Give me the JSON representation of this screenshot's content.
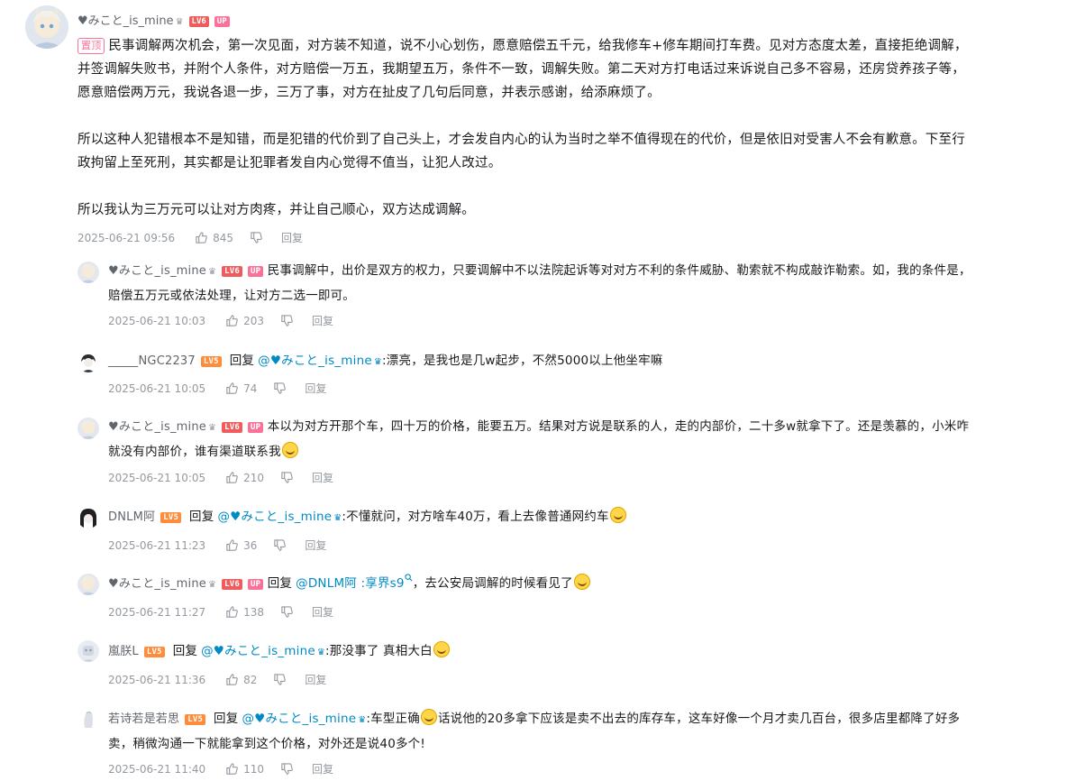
{
  "main_comment": {
    "username": "♥みこと_is_mine",
    "crown": "♛",
    "level": "LV6",
    "up_badge": "UP",
    "pinned_label": "置顶",
    "para1_line1": "民事调解两次机会，第一次见面，对方装不知道，说不小心划伤，愿意赔偿五千元，给我修车+修车期间打车费。见对方态度太差，直接拒绝调解，",
    "para1_line2": "并签调解失败书，并附个人条件，对方赔偿一万五，我期望五万，条件不一致，调解失败。第二天对方打电话过来诉说自己多不容易，还房贷养孩子等，",
    "para1_line3": "愿意赔偿两万元，我说各退一步，三万了事，对方在扯皮了几句后同意，并表示感谢，给添麻烦了。",
    "para2_line1": "所以这种人犯错根本不是知错，而是犯错的代价到了自己头上，才会发自内心的认为当时之举不值得现在的代价，但是依旧对受害人不会有歉意。下至行",
    "para2_line2": "政拘留上至死刑，其实都是让犯罪者发自内心觉得不值当，让犯人改过。",
    "para3": "所以我认为三万元可以让对方肉疼，并让自己顺心，双方达成调解。",
    "time": "2025-06-21 09:56",
    "likes": "845",
    "reply_label": "回复"
  },
  "replies": [
    {
      "username": "♥みこと_is_mine",
      "crown": "♛",
      "level": "LV6",
      "up_badge": "UP",
      "line1": "民事调解中，出价是双方的权力，只要调解中不以法院起诉等对对方不利的条件威胁、勒索就不构成敲诈勒索。如，我的条件是，",
      "line2": "赔偿五万元或依法处理，让对方二选一即可。",
      "time": "2025-06-21 10:03",
      "likes": "203",
      "reply_label": "回复"
    },
    {
      "username": "_____NGC2237",
      "level": "LV5",
      "reply_word": "回复",
      "mention": "@♥みこと_is_mine",
      "mention_crown": "♛",
      "text": ":漂亮，是我也是几w起步，不然5000以上他坐牢嘛",
      "time": "2025-06-21 10:05",
      "likes": "74",
      "reply_label": "回复"
    },
    {
      "username": "♥みこと_is_mine",
      "crown": "♛",
      "level": "LV6",
      "up_badge": "UP",
      "line1": "本以为对方开那个车，四十万的价格，能要五万。结果对方说是联系的人，走的内部价，二十多w就拿下了。还是羡慕的，小米咋",
      "line2": "就没有内部价，谁有渠道联系我",
      "time": "2025-06-21 10:05",
      "likes": "210",
      "reply_label": "回复"
    },
    {
      "username": "DNLM阿",
      "level": "LV5",
      "reply_word": "回复",
      "mention": "@♥みこと_is_mine",
      "mention_crown": "♛",
      "text": ":不懂就问，对方啥车40万，看上去像普通网约车",
      "time": "2025-06-21 11:23",
      "likes": "36",
      "reply_label": "回复"
    },
    {
      "username": "♥みこと_is_mine",
      "crown": "♛",
      "level": "LV6",
      "up_badge": "UP",
      "reply_word": "回复",
      "mention": "@DNLM阿",
      "search_link": ":享界s9",
      "text": "，去公安局调解的时候看见了",
      "time": "2025-06-21 11:27",
      "likes": "138",
      "reply_label": "回复"
    },
    {
      "username": "嵐朕L",
      "level": "LV5",
      "reply_word": "回复",
      "mention": "@♥みこと_is_mine",
      "mention_crown": "♛",
      "text": ":那没事了 真相大白",
      "time": "2025-06-21 11:36",
      "likes": "82",
      "reply_label": "回复"
    },
    {
      "username": "若诗若是若思",
      "level": "LV5",
      "reply_word": "回复",
      "mention": "@♥みこと_is_mine",
      "mention_crown": "♛",
      "text_a": ":车型正确",
      "line1_rest": "话说他的20多拿下应该是卖不出去的库存车，这车好像一个月才卖几百台，很多店里都降了好多",
      "line2": "卖，稍微沟通一下就能拿到这个价格，对外还是说40多个!",
      "time": "2025-06-21 11:40",
      "likes": "110",
      "reply_label": "回复"
    }
  ],
  "colors": {
    "link": "#008ac5",
    "up_badge": "#fb7299",
    "level_red": "#f05c5c",
    "level_orange": "#ff8c3a",
    "meta": "#9499a0"
  },
  "icons": {
    "like": "thumbs-up-icon",
    "dislike": "thumbs-down-icon",
    "search": "search-icon"
  }
}
